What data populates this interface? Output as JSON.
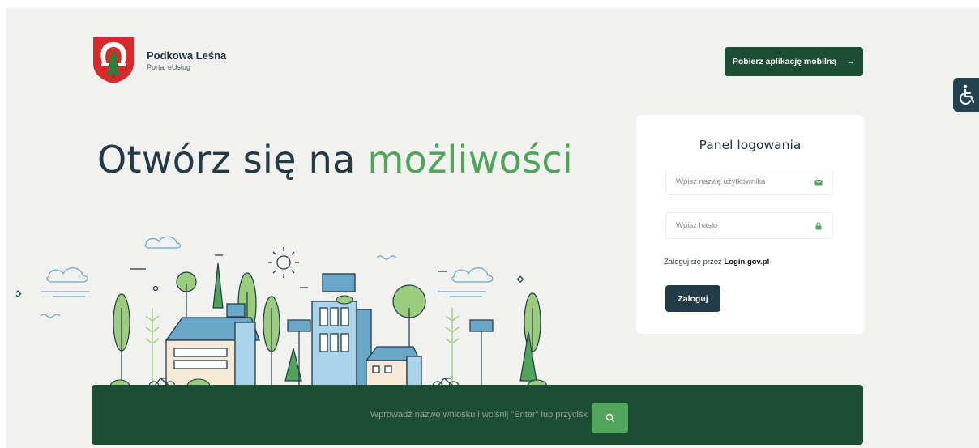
{
  "brand": {
    "name": "Podkowa Leśna",
    "subtitle": "Portal eUsług",
    "crest_icon": "coat-of-arms-icon"
  },
  "header": {
    "app_button_label": "Pobierz aplikację mobilną",
    "app_button_icon": "arrow-right-icon",
    "accessibility_icon": "wheelchair-icon"
  },
  "hero": {
    "headline_part1": "Otwórz się na",
    "headline_accent": "możliwości"
  },
  "login": {
    "title": "Panel logowania",
    "username_placeholder": "Wpisz nazwę użytkownika",
    "username_icon": "envelope-icon",
    "password_placeholder": "Wpisz hasło",
    "password_icon": "lock-icon",
    "alt_text": "Zaloguj się przez",
    "alt_link": "Login.gov.pl",
    "submit_label": "Zaloguj"
  },
  "search": {
    "placeholder": "Wprowadź nazwę wniosku i wciśnij \"Enter\" lub przycisk",
    "button_icon": "search-icon"
  },
  "colors": {
    "dark_green": "#1e4d35",
    "accent_green": "#4fa45a",
    "navy": "#233b48",
    "background": "#f1f2ef"
  }
}
